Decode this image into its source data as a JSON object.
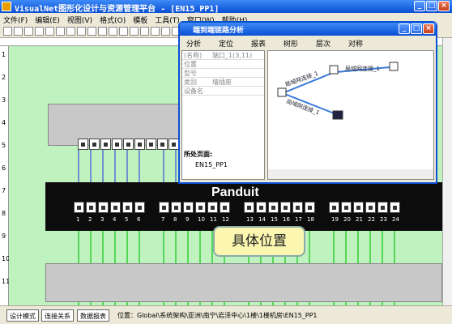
{
  "window": {
    "title": "VisualNet图形化设计与资源管理平台 - [EN15_PP1]"
  },
  "menu": [
    "文件(F)",
    "编辑(E)",
    "视图(V)",
    "格式(O)",
    "模板",
    "工具(T)",
    "窗口(W)",
    "帮助(H)"
  ],
  "ruler": {
    "left_marks": [
      "1",
      "2",
      "3",
      "4",
      "5",
      "6",
      "7",
      "8",
      "9",
      "10",
      "11"
    ]
  },
  "panel": {
    "brand": "Panduit",
    "port_numbers": [
      "1",
      "2",
      "3",
      "4",
      "5",
      "6",
      "7",
      "8",
      "9",
      "10",
      "11",
      "12",
      "13",
      "14",
      "15",
      "16",
      "17",
      "18",
      "19",
      "20",
      "21",
      "22",
      "23",
      "24"
    ]
  },
  "callout": "具体位置",
  "dialog": {
    "title": "端到端链路分析",
    "tools": [
      "分析",
      "定位",
      "报表",
      "树形",
      "层次",
      "对称"
    ],
    "props": [
      {
        "k": "(名称)",
        "v": "端口_1(3,11)"
      },
      {
        "k": "位置",
        "v": ""
      },
      {
        "k": "型号",
        "v": ""
      },
      {
        "k": "类别",
        "v": "墙插座"
      },
      {
        "k": "设备名",
        "v": ""
      }
    ],
    "page_label": "所处页面:",
    "page_value": "EN15_PP1",
    "graph_labels": [
      "局域网连接_1",
      "局域网连接_1",
      "局域网连接_1"
    ]
  },
  "status": {
    "tabs": [
      "设计模式",
      "连接关系",
      "数据报表"
    ],
    "location": "位置：Global\\系统架构\\亚洲\\南宁\\岩泽中心\\1楼\\1楼机房\\EN15_PP1"
  },
  "colors": {
    "canvas": "#bff2bf",
    "blue_line": "#2233dd",
    "green_line": "#33cc33"
  }
}
